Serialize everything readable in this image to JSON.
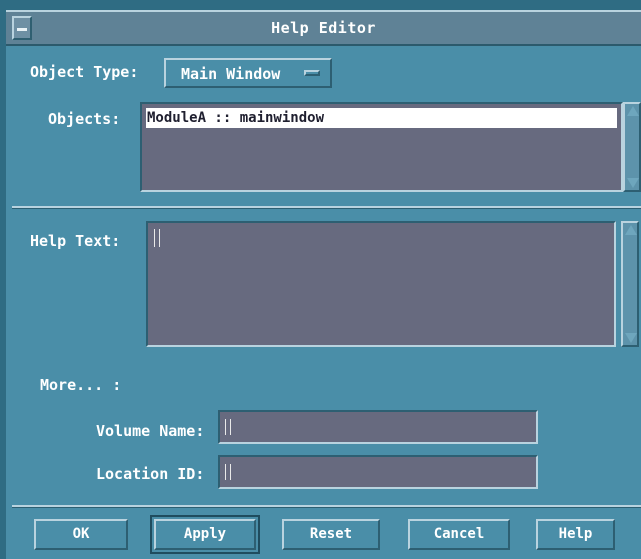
{
  "window": {
    "title": "Help Editor"
  },
  "object_type": {
    "label": "Object Type:",
    "value": "Main Window"
  },
  "objects": {
    "label": "Objects:",
    "items": [
      "ModuleA :: mainwindow"
    ]
  },
  "help_text": {
    "label": "Help Text:",
    "value": ""
  },
  "more": {
    "label": "More... :"
  },
  "volume_name": {
    "label": "Volume Name:",
    "value": ""
  },
  "location_id": {
    "label": "Location ID:",
    "value": ""
  },
  "buttons": {
    "ok": "OK",
    "apply": "Apply",
    "reset": "Reset",
    "cancel": "Cancel",
    "help": "Help"
  },
  "colors": {
    "background": "#4a8ea8",
    "field": "#676a7f",
    "text": "#ffffff"
  }
}
